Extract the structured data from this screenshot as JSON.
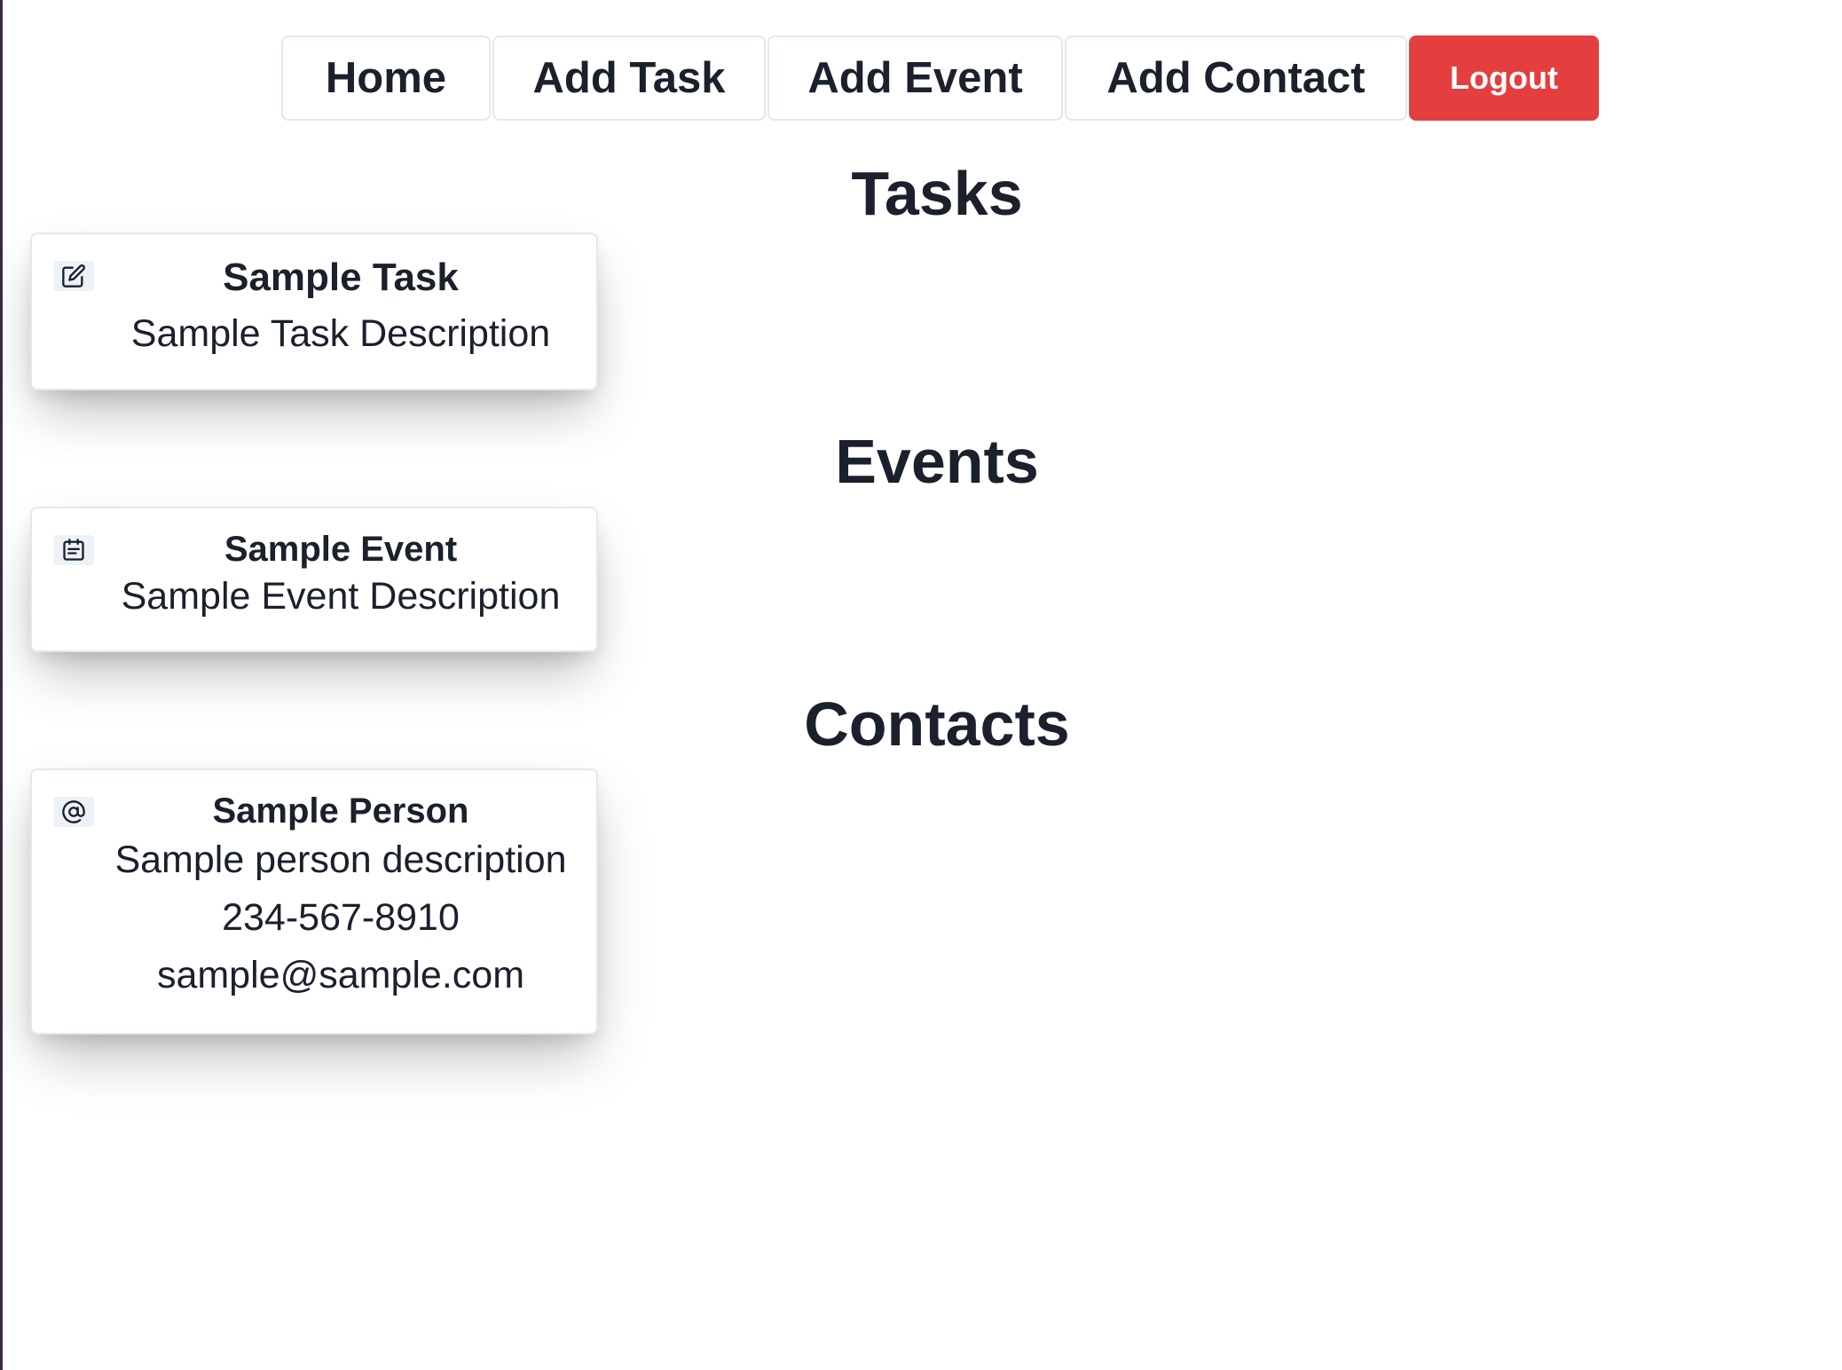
{
  "nav": {
    "home": "Home",
    "add_task": "Add Task",
    "add_event": "Add Event",
    "add_contact": "Add Contact",
    "logout": "Logout"
  },
  "colors": {
    "logout_bg": "#e53e3e",
    "text": "#1a202c",
    "icon_bg": "#edf2f7"
  },
  "sections": {
    "tasks": {
      "heading": "Tasks",
      "items": [
        {
          "icon": "edit-icon",
          "title": "Sample Task",
          "description": "Sample Task Description"
        }
      ]
    },
    "events": {
      "heading": "Events",
      "items": [
        {
          "icon": "calendar-icon",
          "title": "Sample Event",
          "description": "Sample Event Description"
        }
      ]
    },
    "contacts": {
      "heading": "Contacts",
      "items": [
        {
          "icon": "at-sign-icon",
          "title": "Sample Person",
          "description": "Sample person description",
          "phone": "234-567-8910",
          "email": "sample@sample.com"
        }
      ]
    }
  }
}
